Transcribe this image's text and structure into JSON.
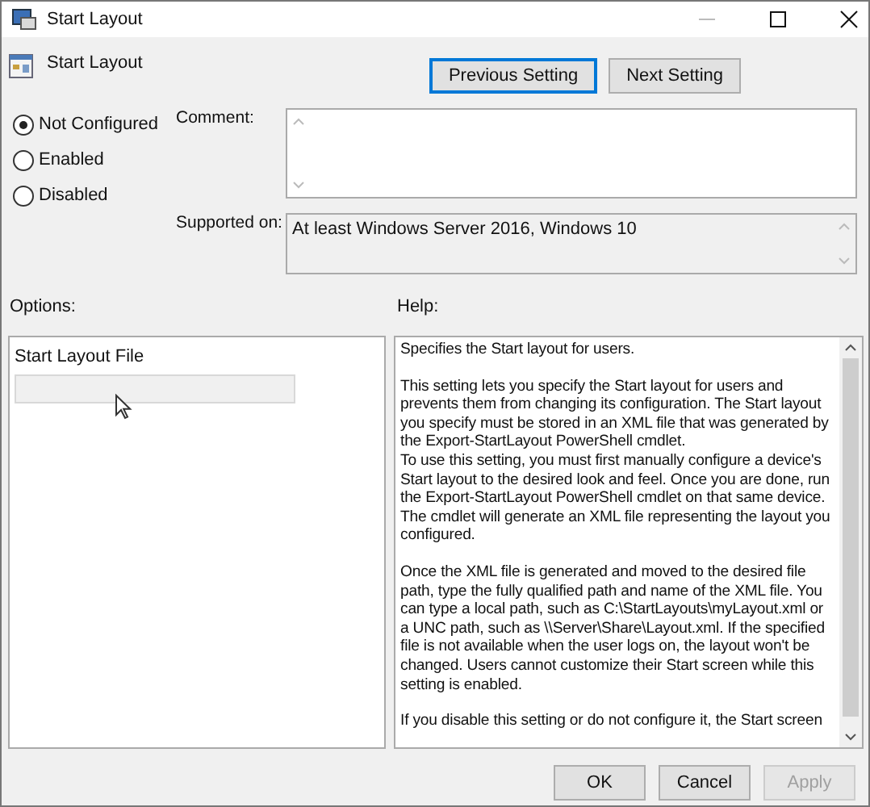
{
  "window": {
    "title": "Start Layout"
  },
  "policy": {
    "name": "Start Layout"
  },
  "nav_buttons": [
    {
      "label": "Previous Setting",
      "focused": true
    },
    {
      "label": "Next Setting",
      "focused": false
    }
  ],
  "states": [
    {
      "label": "Not Configured",
      "selected": true
    },
    {
      "label": "Enabled",
      "selected": false
    },
    {
      "label": "Disabled",
      "selected": false
    }
  ],
  "comment": {
    "label": "Comment:"
  },
  "supported_on": {
    "label": "Supported on:",
    "value": "At least Windows Server 2016, Windows 10"
  },
  "options": {
    "label": "Options:",
    "field_label": "Start Layout File"
  },
  "help": {
    "label": "Help:",
    "paragraphs": [
      "Specifies the Start layout for users.",
      "This setting lets you specify the Start layout for users and prevents them from changing its configuration. The Start layout you specify must be stored in an XML file that was generated by the Export-StartLayout PowerShell cmdlet.\nTo use this setting, you must first manually configure a device's Start layout to the desired look and feel. Once you are done, run the Export-StartLayout PowerShell cmdlet on that same device. The cmdlet will generate an XML file representing the layout you configured.",
      "Once the XML file is generated and moved to the desired file path, type the fully qualified path and name of the XML file. You can type a local path, such as C:\\StartLayouts\\myLayout.xml or a UNC path, such as \\\\Server\\Share\\Layout.xml. If the specified file is not available when the user logs on, the layout won't be changed. Users cannot customize their Start screen while this setting is enabled.",
      "If you disable this setting or do not configure it, the Start screen"
    ]
  },
  "dialog_buttons": [
    {
      "label": "OK",
      "disabled": false
    },
    {
      "label": "Cancel",
      "disabled": false
    },
    {
      "label": "Apply",
      "disabled": true
    }
  ]
}
